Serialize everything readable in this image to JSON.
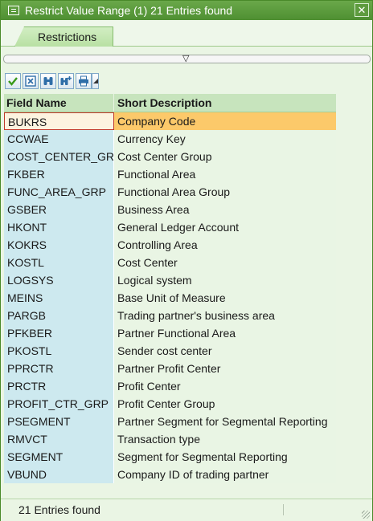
{
  "window": {
    "title": "Restrict Value Range (1)   21 Entries found",
    "close_label": "✕"
  },
  "tabs": [
    {
      "label": "Restrictions"
    }
  ],
  "toolbar": {
    "buttons": [
      {
        "name": "continue-button",
        "icon": "check-icon"
      },
      {
        "name": "cancel-button",
        "icon": "cancel-icon"
      },
      {
        "name": "find-button",
        "icon": "binoculars-icon"
      },
      {
        "name": "find-next-button",
        "icon": "binoculars-plus-icon"
      },
      {
        "name": "print-button",
        "icon": "printer-icon"
      }
    ]
  },
  "table": {
    "headers": [
      "Field Name",
      "Short Description"
    ],
    "rows": [
      {
        "field": "BUKRS",
        "desc": "Company Code"
      },
      {
        "field": "CCWAE",
        "desc": "Currency Key"
      },
      {
        "field": "COST_CENTER_GRP",
        "desc": "Cost Center Group"
      },
      {
        "field": "FKBER",
        "desc": "Functional Area"
      },
      {
        "field": "FUNC_AREA_GRP",
        "desc": "Functional Area Group"
      },
      {
        "field": "GSBER",
        "desc": "Business Area"
      },
      {
        "field": "HKONT",
        "desc": "General Ledger Account"
      },
      {
        "field": "KOKRS",
        "desc": "Controlling Area"
      },
      {
        "field": "KOSTL",
        "desc": "Cost Center"
      },
      {
        "field": "LOGSYS",
        "desc": "Logical system"
      },
      {
        "field": "MEINS",
        "desc": "Base Unit of Measure"
      },
      {
        "field": "PARGB",
        "desc": "Trading partner's business area"
      },
      {
        "field": "PFKBER",
        "desc": "Partner Functional Area"
      },
      {
        "field": "PKOSTL",
        "desc": "Sender cost center"
      },
      {
        "field": "PPRCTR",
        "desc": "Partner Profit Center"
      },
      {
        "field": "PRCTR",
        "desc": "Profit Center"
      },
      {
        "field": "PROFIT_CTR_GRP",
        "desc": "Profit Center Group"
      },
      {
        "field": "PSEGMENT",
        "desc": "Partner Segment for Segmental Reporting"
      },
      {
        "field": "RMVCT",
        "desc": "Transaction type"
      },
      {
        "field": "SEGMENT",
        "desc": "Segment for Segmental Reporting"
      },
      {
        "field": "VBUND",
        "desc": "Company ID of trading partner"
      }
    ]
  },
  "status": {
    "text": "21 Entries found"
  },
  "colors": {
    "titlebar": "#4e8f32",
    "selected_row": "#fcc96a",
    "field_column": "#cde9ef"
  }
}
